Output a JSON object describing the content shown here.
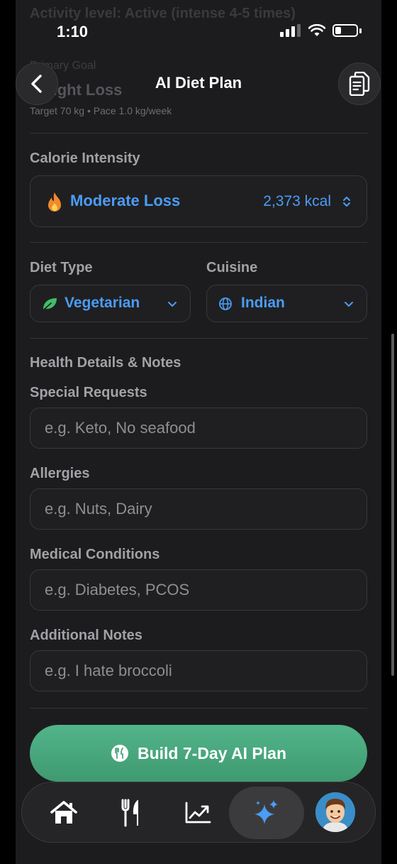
{
  "status": {
    "time": "1:10"
  },
  "background_summary": {
    "activity": "Activity level: Active (intense 4-5 times)",
    "goal_label": "Primary Goal",
    "goal": "Weight Loss",
    "target": "Target 70 kg • Pace 1.0 kg/week"
  },
  "nav": {
    "title": "AI Diet Plan",
    "back_icon": "chevron-left-icon",
    "copy_icon": "copy-icon"
  },
  "calorie": {
    "label": "Calorie Intensity",
    "value": "Moderate Loss",
    "kcal": "2,373 kcal",
    "icon": "flame-icon"
  },
  "diet": {
    "label": "Diet Type",
    "value": "Vegetarian",
    "icon": "leaf-icon"
  },
  "cuisine": {
    "label": "Cuisine",
    "value": "Indian",
    "icon": "globe-icon"
  },
  "health": {
    "section_label": "Health Details & Notes",
    "special": {
      "label": "Special Requests",
      "placeholder": "e.g. Keto, No seafood"
    },
    "allergies": {
      "label": "Allergies",
      "placeholder": "e.g. Nuts, Dairy"
    },
    "medical": {
      "label": "Medical Conditions",
      "placeholder": "e.g. Diabetes, PCOS"
    },
    "notes": {
      "label": "Additional Notes",
      "placeholder": "e.g. I hate broccoli"
    }
  },
  "build_button": {
    "label": "Build 7-Day AI Plan",
    "icon": "fork-knife-icon"
  },
  "tabbar": {
    "items": [
      "home-icon",
      "fork-knife-icon",
      "chart-icon",
      "sparkles-icon",
      "avatar"
    ],
    "active": "sparkles-icon"
  },
  "colors": {
    "accent": "#4b9cf5",
    "green": "#4aa87e",
    "background": "#1c1c1e",
    "flame": "#f08a2a",
    "leaf": "#3fbf6a"
  }
}
